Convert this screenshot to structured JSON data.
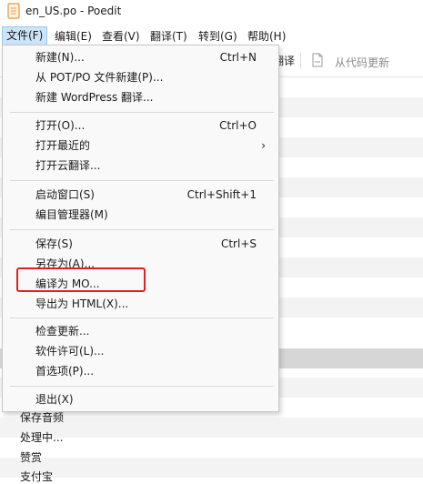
{
  "window": {
    "title": "en_US.po - Poedit"
  },
  "menubar": {
    "items": [
      "文件(F)",
      "编辑(E)",
      "查看(V)",
      "翻译(T)",
      "转到(G)",
      "帮助(H)"
    ]
  },
  "toolbar": {
    "partial_label": "翻译",
    "update_from_source": "从代码更新"
  },
  "file_menu": {
    "items": [
      {
        "label": "新建(N)...",
        "shortcut": "Ctrl+N"
      },
      {
        "label": "从 POT/PO 文件新建(P)...",
        "shortcut": ""
      },
      {
        "label": "新建 WordPress 翻译...",
        "shortcut": ""
      },
      {
        "label": "打开(O)...",
        "shortcut": "Ctrl+O"
      },
      {
        "label": "打开最近的",
        "shortcut": "",
        "submenu_arrow": "›"
      },
      {
        "label": "打开云翻译...",
        "shortcut": ""
      },
      {
        "label": "启动窗口(S)",
        "shortcut": "Ctrl+Shift+1"
      },
      {
        "label": "编目管理器(M)",
        "shortcut": ""
      },
      {
        "label": "保存(S)",
        "shortcut": "Ctrl+S"
      },
      {
        "label": "另存为(A)...",
        "shortcut": ""
      },
      {
        "label": "编译为 MO...",
        "shortcut": "",
        "highlighted": true
      },
      {
        "label": "导出为 HTML(X)...",
        "shortcut": ""
      },
      {
        "label": "检查更新...",
        "shortcut": ""
      },
      {
        "label": "软件许可(L)...",
        "shortcut": ""
      },
      {
        "label": "首选项(P)...",
        "shortcut": ""
      },
      {
        "label": "退出(X)",
        "shortcut": ""
      }
    ]
  },
  "string_list": {
    "visible_items": [
      "保存音频",
      "处理中...",
      "赞赏",
      "支付宝"
    ]
  },
  "colors": {
    "menu_active_bg": "#cce4f7",
    "highlight_border": "#e02020",
    "menu_bg": "#f9f9f9"
  }
}
